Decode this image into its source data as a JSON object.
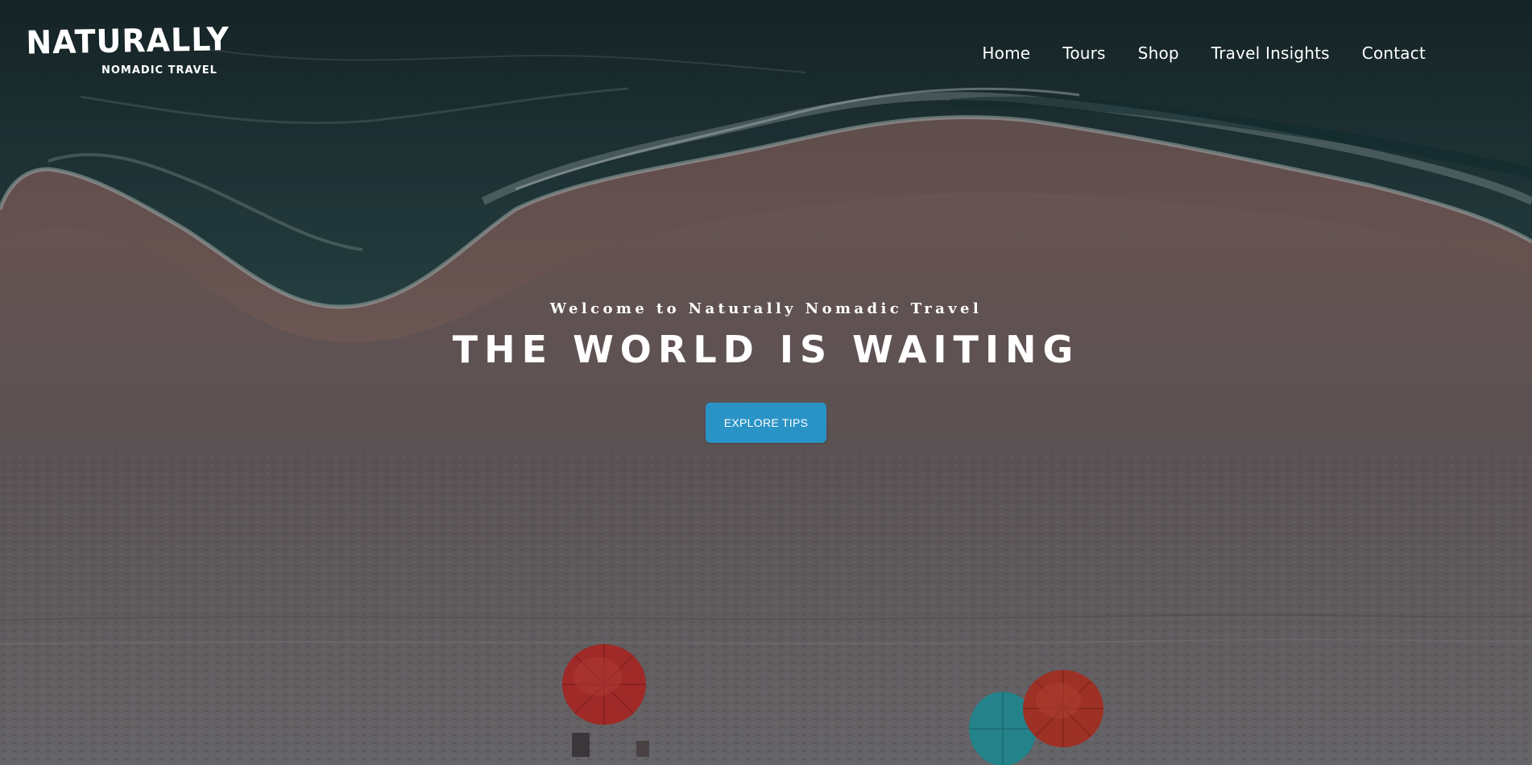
{
  "site": {
    "logo_main": "NATURALLY",
    "logo_sub": "NOMADIC TRAVEL"
  },
  "nav": {
    "items": [
      {
        "label": "Home"
      },
      {
        "label": "Tours"
      },
      {
        "label": "Shop"
      },
      {
        "label": "Travel Insights"
      },
      {
        "label": "Contact"
      }
    ]
  },
  "hero": {
    "tagline": "Welcome to Naturally Nomadic Travel",
    "title": "THE WORLD IS WAITING",
    "button_label": "EXPLORE TIPS",
    "background_image": "aerial-beach-with-umbrellas"
  },
  "colors": {
    "accent": "#2a93c6",
    "ocean": "#1f3a3d",
    "sand": "#8f7068",
    "umbrella_red": "#c8322e",
    "umbrella_teal": "#2aa3ad"
  }
}
